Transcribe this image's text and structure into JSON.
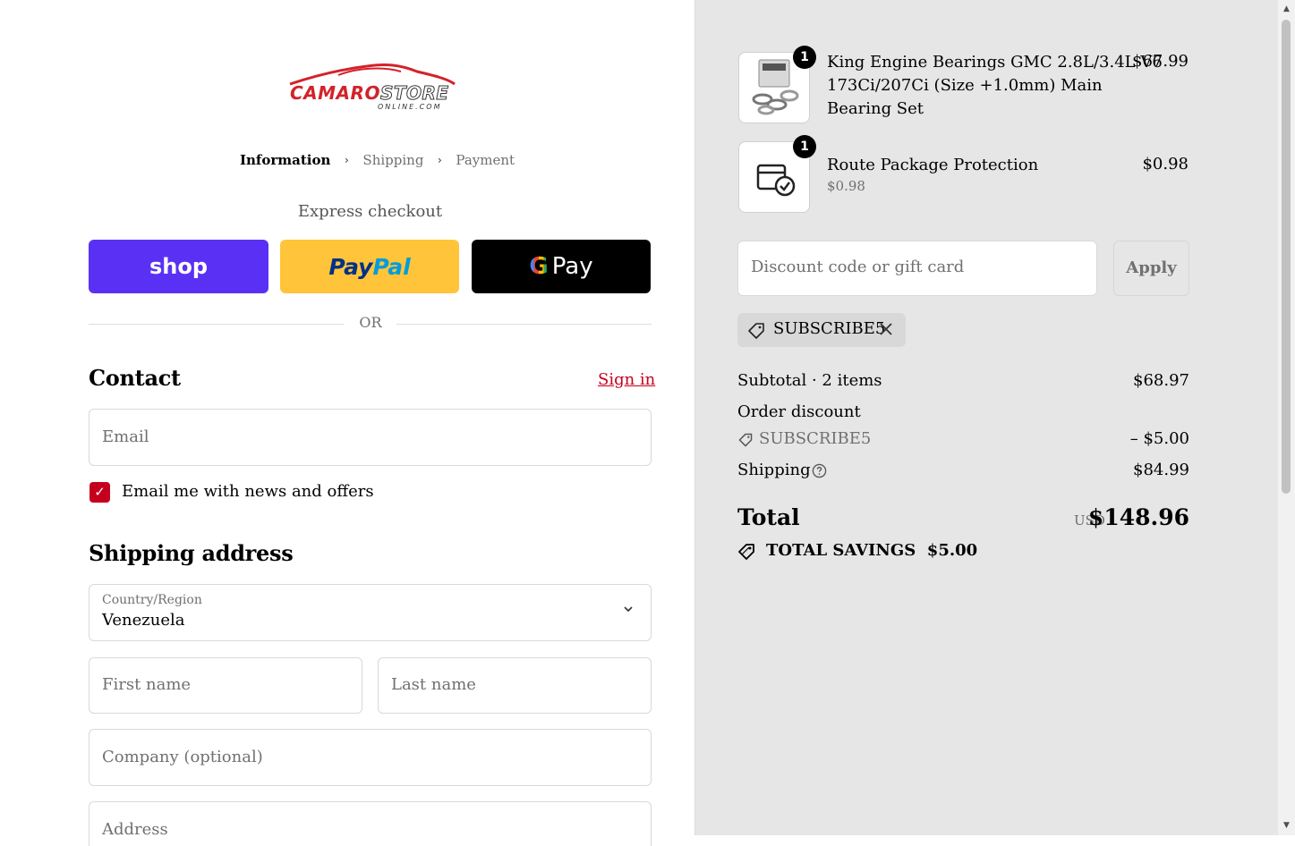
{
  "brand": {
    "logo_main": "CAMARO",
    "logo_store": "STORE",
    "logo_sub": "ONLINE.COM"
  },
  "breadcrumb": {
    "step1": "Information",
    "step2": "Shipping",
    "step3": "Payment"
  },
  "express": {
    "title": "Express checkout",
    "shop_label": "shop",
    "paypal_part1": "Pay",
    "paypal_part2": "Pal",
    "gpay_g": "G",
    "gpay_label": "Pay",
    "or_text": "OR"
  },
  "contact": {
    "heading": "Contact",
    "signin_label": "Sign in",
    "email_placeholder": "Email",
    "newsletter_label": "Email me with news and offers",
    "newsletter_checked": true
  },
  "shipping_address": {
    "heading": "Shipping address",
    "country_label": "Country/Region",
    "country_value": "Venezuela",
    "first_name_placeholder": "First name",
    "last_name_placeholder": "Last name",
    "company_placeholder": "Company (optional)",
    "address_placeholder": "Address"
  },
  "cart": {
    "items": [
      {
        "qty": "1",
        "name_line1": "King Engine Bearings GMC 2.8L/3.4L V6",
        "name_line2": "173Ci/207Ci (Size +1.0mm) Main",
        "name_line3": "Bearing Set",
        "price": "$67.99"
      },
      {
        "qty": "1",
        "name_line1": "Route Package Protection",
        "sub": "$0.98",
        "price": "$0.98"
      }
    ],
    "discount_placeholder": "Discount code or gift card",
    "apply_label": "Apply",
    "applied_code": "SUBSCRIBE5"
  },
  "summary": {
    "subtotal_label": "Subtotal · 2 items",
    "subtotal_value": "$68.97",
    "order_discount_label": "Order discount",
    "discount_code": "SUBSCRIBE5",
    "discount_value": "– $5.00",
    "shipping_label": "Shipping",
    "shipping_value": "$84.99",
    "total_label": "Total",
    "currency": "USD",
    "total_value": "$148.96",
    "savings_label": "TOTAL SAVINGS",
    "savings_value": "$5.00"
  },
  "colors": {
    "accent": "#c5001d",
    "shop": "#5a31f4",
    "paypal": "#ffc439",
    "gpay": "#000000",
    "panel": "#e6e6e6"
  }
}
